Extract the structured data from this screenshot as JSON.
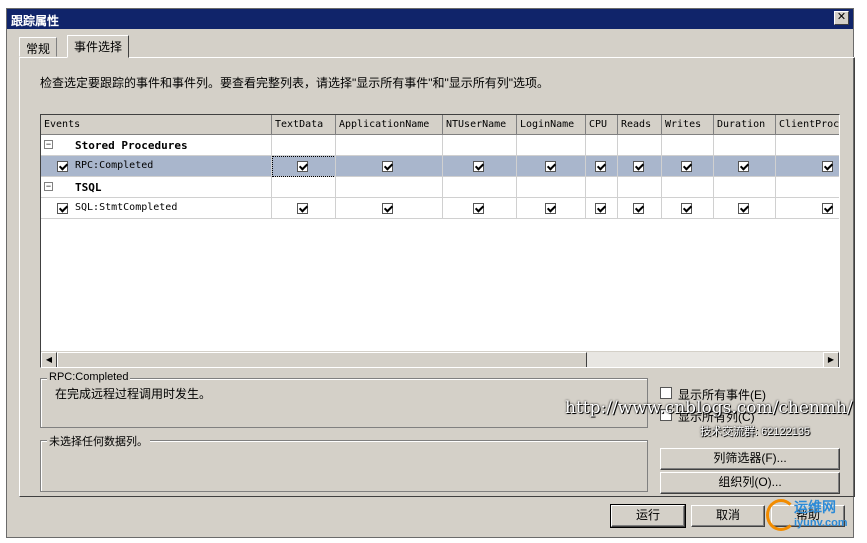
{
  "window": {
    "title": "跟踪属性",
    "close_glyph": "✕"
  },
  "tabs": [
    {
      "label": "常规"
    },
    {
      "label": "事件选择"
    }
  ],
  "instruction": "检查选定要跟踪的事件和事件列。要查看完整列表，请选择\"显示所有事件\"和\"显示所有列\"选项。",
  "grid": {
    "columns": [
      "Events",
      "TextData",
      "ApplicationName",
      "NTUserName",
      "LoginName",
      "CPU",
      "Reads",
      "Writes",
      "Duration",
      "ClientProc"
    ],
    "categories": [
      {
        "name": "Stored Procedures",
        "expander": "−",
        "events": [
          {
            "name": "RPC:Completed",
            "checked": true,
            "selected": true
          }
        ]
      },
      {
        "name": "TSQL",
        "expander": "−",
        "events": [
          {
            "name": "SQL:StmtCompleted",
            "checked": true,
            "selected": false
          }
        ]
      }
    ]
  },
  "scroll": {
    "left_glyph": "◀",
    "right_glyph": "▶"
  },
  "description_box": {
    "title": "RPC:Completed",
    "text": "在完成远程过程调用时发生。"
  },
  "column_box": {
    "title": "未选择任何数据列。"
  },
  "options": {
    "show_all_events": "显示所有事件(E)",
    "show_all_columns": "显示所有列(C)"
  },
  "buttons": {
    "column_filters": "列筛选器(F)...",
    "organize_columns": "组织列(O)...",
    "run": "运行",
    "cancel": "取消",
    "help": "帮助"
  },
  "watermark": {
    "url": "http://www.cnblogs.com/chenmh/",
    "group": "技术交流群: 62122135"
  },
  "logo": {
    "line1": "运维网",
    "line2": "iyunv.com"
  }
}
